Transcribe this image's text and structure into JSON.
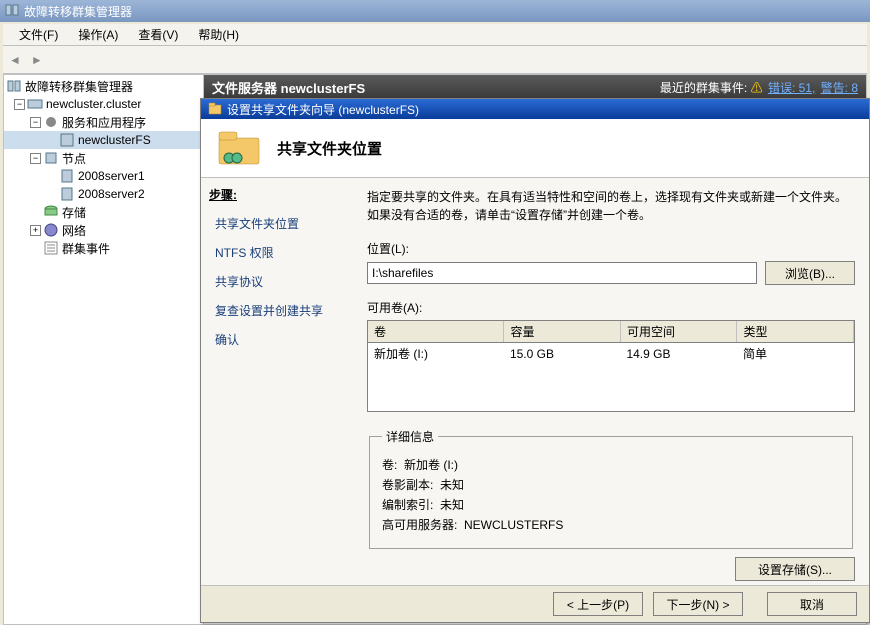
{
  "app": {
    "title": "故障转移群集管理器",
    "menus": [
      "文件(F)",
      "操作(A)",
      "查看(V)",
      "帮助(H)"
    ]
  },
  "tree": {
    "root": "故障转移群集管理器",
    "cluster": "newcluster.cluster",
    "services_apps": "服务和应用程序",
    "fs_instance": "newclusterFS",
    "nodes": "节点",
    "node1": "2008server1",
    "node2": "2008server2",
    "storage": "存储",
    "network": "网络",
    "events": "群集事件"
  },
  "right": {
    "title_prefix": "文件服务器",
    "title_name": "newclusterFS",
    "events_label": "最近的群集事件:",
    "errors_label": "错误: 51,",
    "warnings_label": "警告: 8"
  },
  "wizard": {
    "title": "设置共享文件夹向导 (newclusterFS)",
    "heading": "共享文件夹位置",
    "steps_title": "步骤:",
    "steps": [
      "共享文件夹位置",
      "NTFS 权限",
      "共享协议",
      "复查设置并创建共享",
      "确认"
    ],
    "description": "指定要共享的文件夹。在具有适当特性和空间的卷上，选择现有文件夹或新建一个文件夹。如果没有合适的卷，请单击“设置存储”并创建一个卷。",
    "location_label": "位置(L):",
    "location_value": "I:\\sharefiles",
    "browse_btn": "浏览(B)...",
    "volumes_label": "可用卷(A):",
    "vol_headers": [
      "卷",
      "容量",
      "可用空间",
      "类型"
    ],
    "vol_row": {
      "name": "新加卷 (I:)",
      "capacity": "15.0 GB",
      "free": "14.9 GB",
      "type": "简单"
    },
    "details_legend": "详细信息",
    "detail_volume_label": "卷:",
    "detail_volume_value": "新加卷 (I:)",
    "detail_shadow_label": "卷影副本:",
    "detail_shadow_value": "未知",
    "detail_index_label": "编制索引:",
    "detail_index_value": "未知",
    "detail_ha_label": "高可用服务器:",
    "detail_ha_value": "NEWCLUSTERFS",
    "storage_btn": "设置存储(S)...",
    "back_btn": "< 上一步(P)",
    "next_btn": "下一步(N) >",
    "cancel_btn": "取消"
  }
}
